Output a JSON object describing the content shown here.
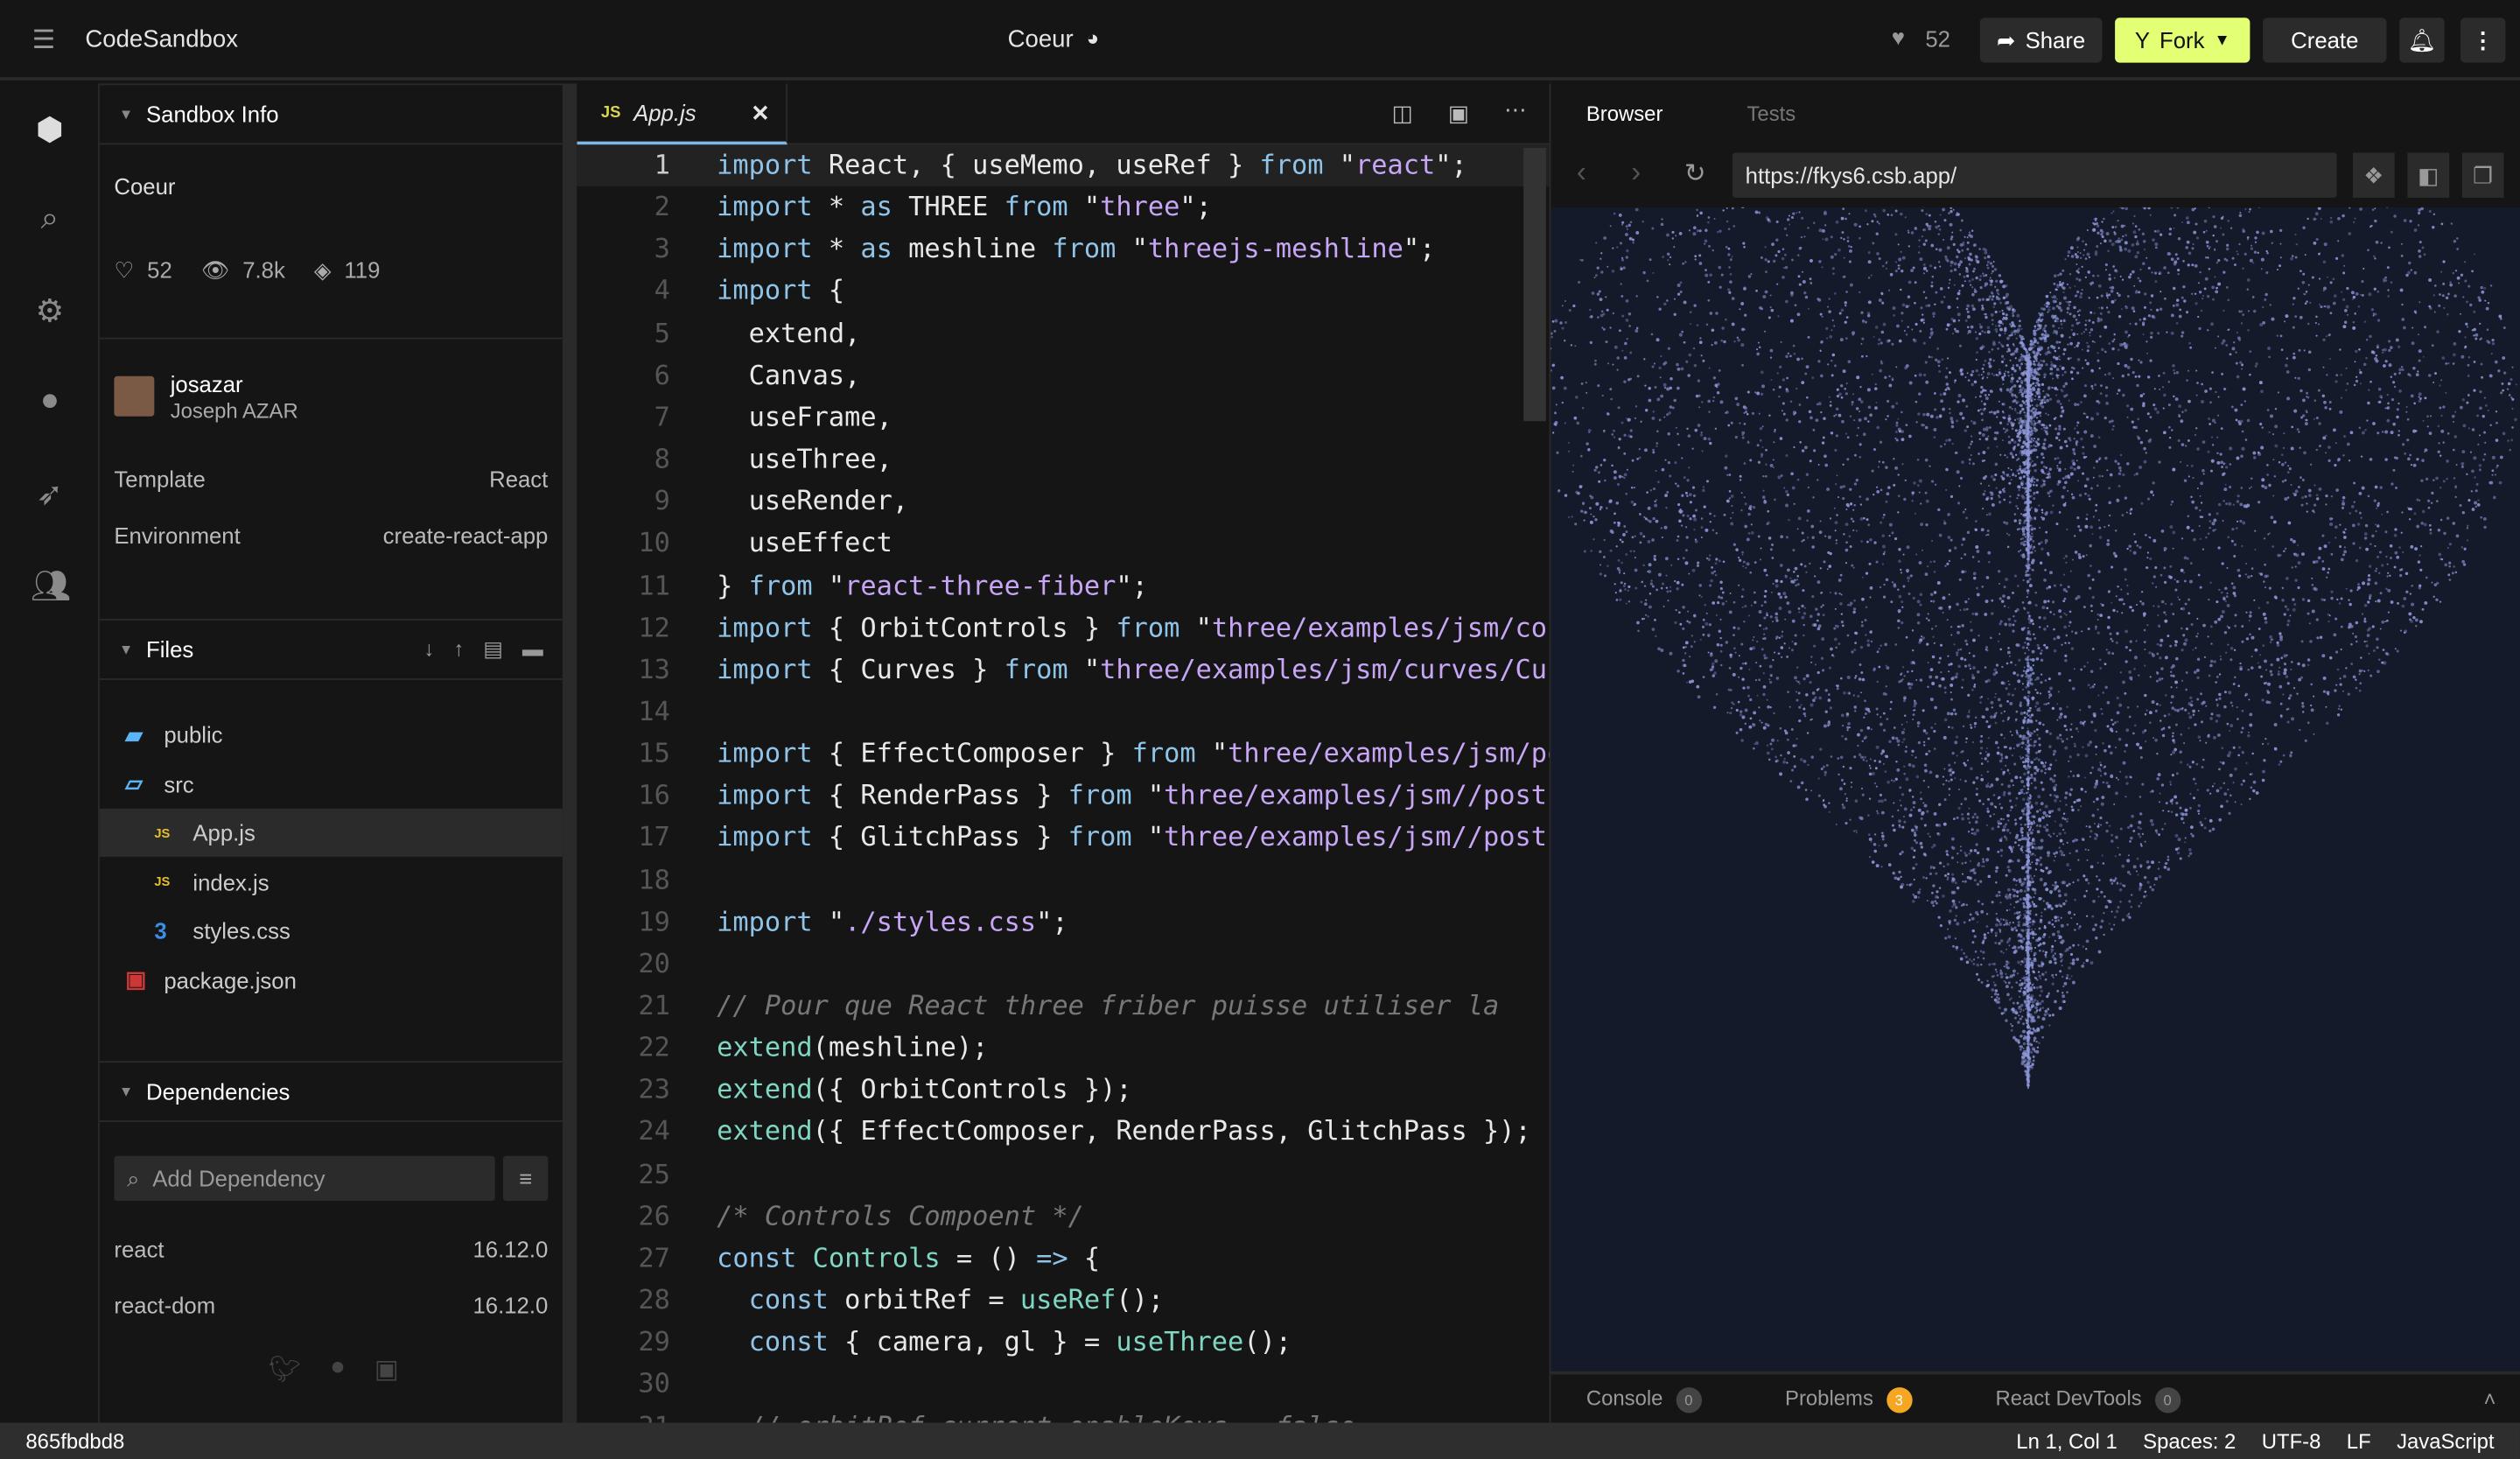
{
  "app": {
    "title": "CodeSandbox",
    "sandbox_name": "Coeur"
  },
  "header": {
    "likes": "52",
    "share": "Share",
    "fork": "Fork",
    "create": "Create",
    "accent": "#e3ff73"
  },
  "activity_bar": [
    "cube-icon",
    "search-icon",
    "gear-icon",
    "github-icon",
    "rocket-icon",
    "users-icon"
  ],
  "sidebar": {
    "info_title": "Sandbox Info",
    "name": "Coeur",
    "likes": "52",
    "views": "7.8k",
    "forks": "119",
    "author_user": "josazar",
    "author_name": "Joseph AZAR",
    "template_label": "Template",
    "template_value": "React",
    "env_label": "Environment",
    "env_value": "create-react-app",
    "files_title": "Files",
    "files": [
      {
        "name": "public",
        "type": "folder",
        "indent": 0
      },
      {
        "name": "src",
        "type": "folder-open",
        "indent": 0
      },
      {
        "name": "App.js",
        "type": "js",
        "indent": 1,
        "active": true
      },
      {
        "name": "index.js",
        "type": "js",
        "indent": 1
      },
      {
        "name": "styles.css",
        "type": "css",
        "indent": 1
      },
      {
        "name": "package.json",
        "type": "npm",
        "indent": 0
      }
    ],
    "deps_title": "Dependencies",
    "dep_placeholder": "Add Dependency",
    "deps": [
      {
        "name": "react",
        "version": "16.12.0"
      },
      {
        "name": "react-dom",
        "version": "16.12.0"
      }
    ]
  },
  "editor": {
    "tab": "App.js",
    "tab_badge": "JS",
    "lines": [
      [
        [
          "kw",
          "import"
        ],
        [
          "pl",
          " React, { useMemo, useRef } "
        ],
        [
          "kw",
          "from"
        ],
        [
          "pl",
          " \""
        ],
        [
          "str",
          "react"
        ],
        [
          "pl",
          "\";"
        ]
      ],
      [
        [
          "kw",
          "import"
        ],
        [
          "pl",
          " * "
        ],
        [
          "kw",
          "as"
        ],
        [
          "pl",
          " THREE "
        ],
        [
          "kw",
          "from"
        ],
        [
          "pl",
          " \""
        ],
        [
          "str",
          "three"
        ],
        [
          "pl",
          "\";"
        ]
      ],
      [
        [
          "kw",
          "import"
        ],
        [
          "pl",
          " * "
        ],
        [
          "kw",
          "as"
        ],
        [
          "pl",
          " meshline "
        ],
        [
          "kw",
          "from"
        ],
        [
          "pl",
          " \""
        ],
        [
          "str",
          "threejs-meshline"
        ],
        [
          "pl",
          "\";"
        ]
      ],
      [
        [
          "kw",
          "import"
        ],
        [
          "pl",
          " {"
        ]
      ],
      [
        [
          "pl",
          "  extend,"
        ]
      ],
      [
        [
          "pl",
          "  Canvas,"
        ]
      ],
      [
        [
          "pl",
          "  useFrame,"
        ]
      ],
      [
        [
          "pl",
          "  useThree,"
        ]
      ],
      [
        [
          "pl",
          "  useRender,"
        ]
      ],
      [
        [
          "pl",
          "  useEffect"
        ]
      ],
      [
        [
          "pl",
          "} "
        ],
        [
          "kw",
          "from"
        ],
        [
          "pl",
          " \""
        ],
        [
          "str",
          "react-three-fiber"
        ],
        [
          "pl",
          "\";"
        ]
      ],
      [
        [
          "kw",
          "import"
        ],
        [
          "pl",
          " { OrbitControls } "
        ],
        [
          "kw",
          "from"
        ],
        [
          "pl",
          " \""
        ],
        [
          "str",
          "three/examples/jsm/controls/OrbitControls"
        ],
        [
          "pl",
          "\";"
        ]
      ],
      [
        [
          "kw",
          "import"
        ],
        [
          "pl",
          " { Curves } "
        ],
        [
          "kw",
          "from"
        ],
        [
          "pl",
          " \""
        ],
        [
          "str",
          "three/examples/jsm/curves/CurveExtras"
        ],
        [
          "pl",
          "\";"
        ]
      ],
      [],
      [
        [
          "kw",
          "import"
        ],
        [
          "pl",
          " { EffectComposer } "
        ],
        [
          "kw",
          "from"
        ],
        [
          "pl",
          " \""
        ],
        [
          "str",
          "three/examples/jsm/postprocessing"
        ],
        [
          "pl",
          "\";"
        ]
      ],
      [
        [
          "kw",
          "import"
        ],
        [
          "pl",
          " { RenderPass } "
        ],
        [
          "kw",
          "from"
        ],
        [
          "pl",
          " \""
        ],
        [
          "str",
          "three/examples/jsm//postprocessing"
        ],
        [
          "pl",
          "\";"
        ]
      ],
      [
        [
          "kw",
          "import"
        ],
        [
          "pl",
          " { GlitchPass } "
        ],
        [
          "kw",
          "from"
        ],
        [
          "pl",
          " \""
        ],
        [
          "str",
          "three/examples/jsm//postprocessing"
        ],
        [
          "pl",
          "\";"
        ]
      ],
      [],
      [
        [
          "kw",
          "import"
        ],
        [
          "pl",
          " \""
        ],
        [
          "str",
          "./styles.css"
        ],
        [
          "pl",
          "\";"
        ]
      ],
      [],
      [
        [
          "cm",
          "// Pour que React three friber puisse utiliser la"
        ]
      ],
      [
        [
          "fn",
          "extend"
        ],
        [
          "pl",
          "(meshline);"
        ]
      ],
      [
        [
          "fn",
          "extend"
        ],
        [
          "pl",
          "({ OrbitControls });"
        ]
      ],
      [
        [
          "fn",
          "extend"
        ],
        [
          "pl",
          "({ EffectComposer, RenderPass, GlitchPass });"
        ]
      ],
      [],
      [
        [
          "cm",
          "/* Controls Compoent */"
        ]
      ],
      [
        [
          "kw",
          "const"
        ],
        [
          "pl",
          " "
        ],
        [
          "fn",
          "Controls"
        ],
        [
          "pl",
          " = () "
        ],
        [
          "kw",
          "=>"
        ],
        [
          "pl",
          " {"
        ]
      ],
      [
        [
          "pl",
          "  "
        ],
        [
          "kw",
          "const"
        ],
        [
          "pl",
          " orbitRef = "
        ],
        [
          "fn",
          "useRef"
        ],
        [
          "pl",
          "();"
        ]
      ],
      [
        [
          "pl",
          "  "
        ],
        [
          "kw",
          "const"
        ],
        [
          "pl",
          " { camera, gl } = "
        ],
        [
          "fn",
          "useThree"
        ],
        [
          "pl",
          "();"
        ]
      ],
      [],
      [
        [
          "cm",
          "  // orbitRef.current.enableKeys = false"
        ]
      ]
    ]
  },
  "preview": {
    "tab_browser": "Browser",
    "tab_tests": "Tests",
    "url": "https://fkys6.csb.app/",
    "heart_color": "#8d97d8",
    "bg": "#151a2b",
    "console": "Console",
    "console_count": "0",
    "problems": "Problems",
    "problems_count": "3",
    "devtools": "React DevTools",
    "devtools_count": "0"
  },
  "status": {
    "commit": "865fbdbd8",
    "position": "Ln 1, Col 1",
    "spaces": "Spaces: 2",
    "encoding": "UTF-8",
    "eol": "LF",
    "language": "JavaScript"
  }
}
